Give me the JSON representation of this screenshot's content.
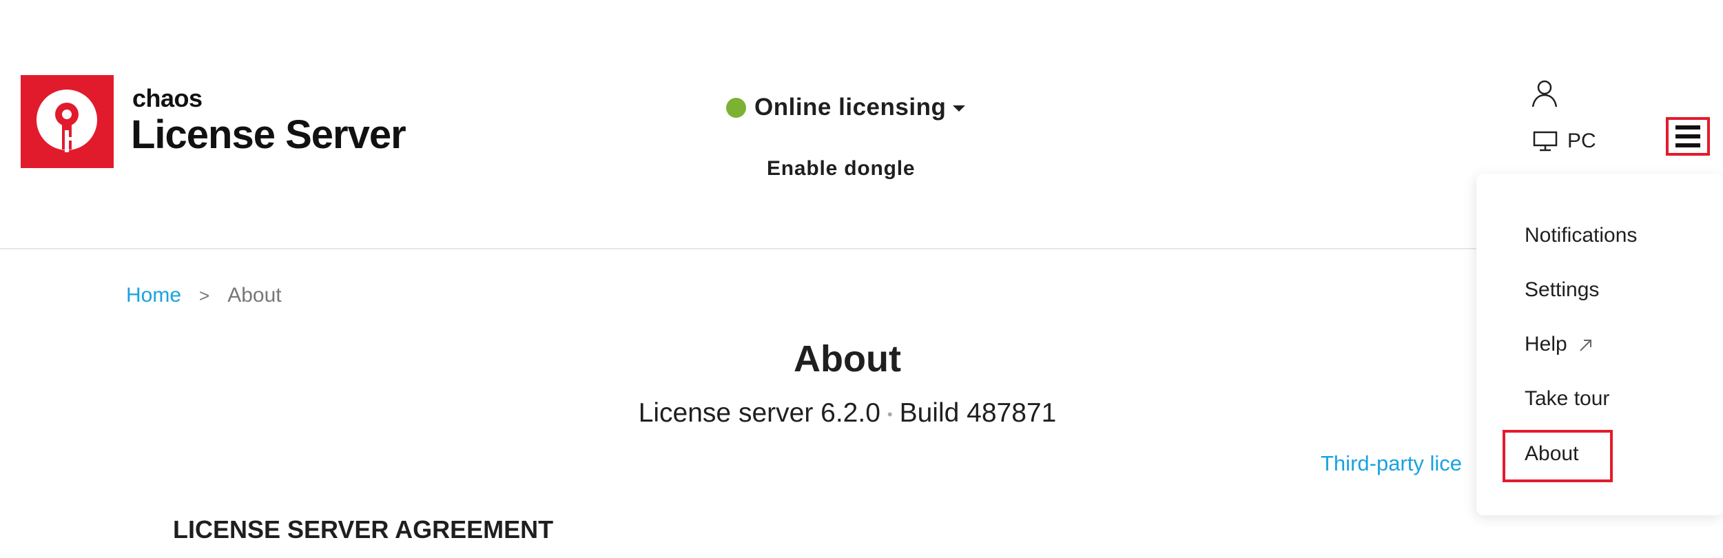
{
  "header": {
    "brand_small": "chaos",
    "brand_big": "License Server",
    "licensing": {
      "label": "Online licensing",
      "status_color": "#7cb234"
    },
    "enable_dongle": "Enable dongle",
    "machine": {
      "label": "PC"
    }
  },
  "breadcrumb": {
    "home": "Home",
    "separator": ">",
    "current": "About"
  },
  "main": {
    "title": "About",
    "version": "License server 6.2.0",
    "version_separator": "•",
    "build": "Build 487871",
    "third_party_link": "Third-party lice",
    "agreement_heading": "LICENSE SERVER AGREEMENT"
  },
  "menu": {
    "items": [
      {
        "label": "Notifications"
      },
      {
        "label": "Settings"
      },
      {
        "label": "Help"
      },
      {
        "label": "Take tour"
      },
      {
        "label": "About"
      }
    ]
  },
  "colors": {
    "accent": "#e21b2c",
    "link": "#1aa3e0",
    "status_online": "#7cb234"
  },
  "icons": [
    "key-logo-icon",
    "caret-down-icon",
    "user-icon",
    "monitor-icon",
    "hamburger-icon",
    "external-link-icon"
  ]
}
